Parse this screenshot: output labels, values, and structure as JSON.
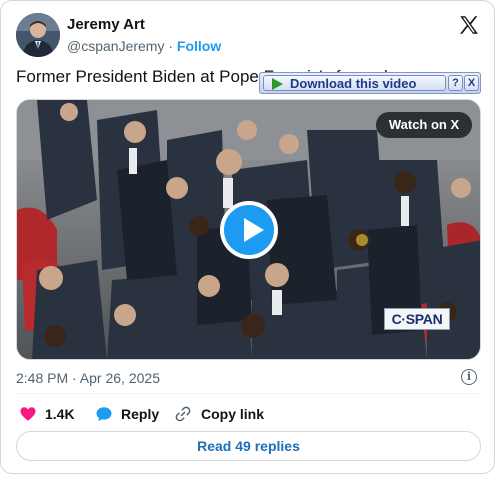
{
  "author": {
    "name": "Jeremy Art",
    "handle": "@cspanJeremy",
    "separator": "·",
    "follow_label": "Follow"
  },
  "icons": {
    "x_logo": "x-logo-icon",
    "info": "info-icon",
    "heart": "heart-icon",
    "reply": "reply-bubble-icon",
    "link": "link-icon",
    "play": "play-icon"
  },
  "tweet": {
    "text": "Former President Biden at Pope Francis's funeral"
  },
  "media": {
    "watch_label": "Watch on X",
    "network_logo": "C·SPAN"
  },
  "download_bar": {
    "label": "Download this video",
    "help_label": "?",
    "close_label": "X"
  },
  "meta": {
    "timestamp": "2:48 PM · Apr 26, 2025",
    "info_label": "i"
  },
  "actions": {
    "likes_count": "1.4K",
    "reply_label": "Reply",
    "copy_link_label": "Copy link"
  },
  "replies_button": {
    "label": "Read 49 replies"
  },
  "colors": {
    "accent": "#1d9bf0",
    "heart": "#f91880",
    "text_secondary": "#536471",
    "border": "#cfd9de"
  }
}
